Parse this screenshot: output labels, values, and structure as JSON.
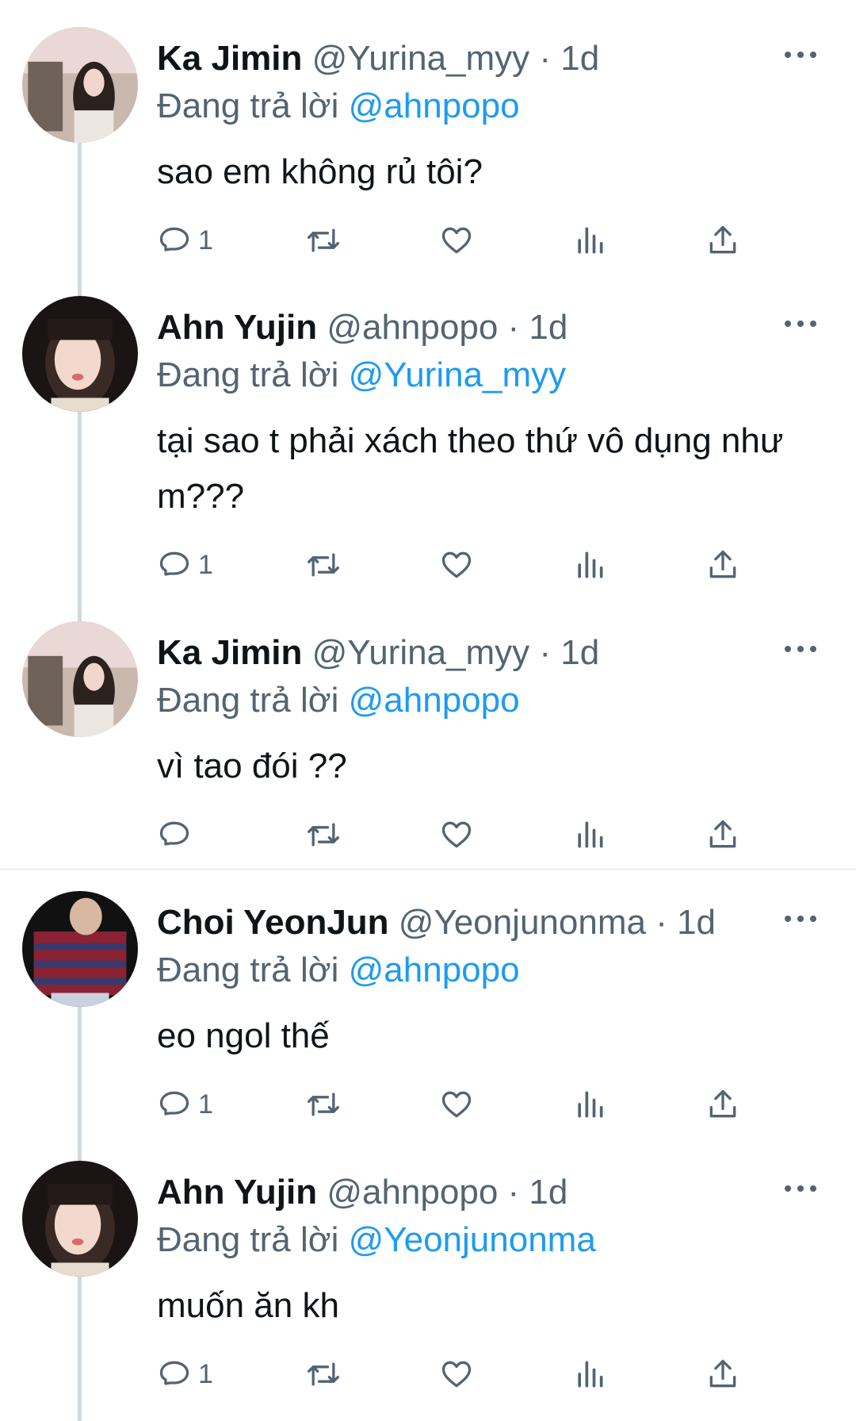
{
  "reply_prefix": "Đang trả lời",
  "tweets": [
    {
      "name": "Ka Jimin",
      "handle": "@Yurina_myy",
      "time": "· 1d",
      "reply_to": "@ahnpopo",
      "text": "sao em không rủ tôi?",
      "reply_count": "1"
    },
    {
      "name": "Ahn Yujin",
      "handle": "@ahnpopo",
      "time": "· 1d",
      "reply_to": "@Yurina_myy",
      "text": "tại sao t phải xách theo thứ vô dụng như m???",
      "reply_count": "1"
    },
    {
      "name": "Ka Jimin",
      "handle": "@Yurina_myy",
      "time": "· 1d",
      "reply_to": "@ahnpopo",
      "text": "vì tao đói ??",
      "reply_count": ""
    },
    {
      "name": "Choi YeonJun",
      "handle": "@Yeonjunonma",
      "time": "· 1d",
      "reply_to": "@ahnpopo",
      "text": "eo ngol thế",
      "reply_count": "1"
    },
    {
      "name": "Ahn Yujin",
      "handle": "@ahnpopo",
      "time": "· 1d",
      "reply_to": "@Yeonjunonma",
      "text": "muốn ăn kh",
      "reply_count": "1"
    }
  ],
  "colors": {
    "link": "#1d9bf0",
    "muted": "#536471",
    "text": "#0f1419",
    "thread": "#cfd9de"
  }
}
